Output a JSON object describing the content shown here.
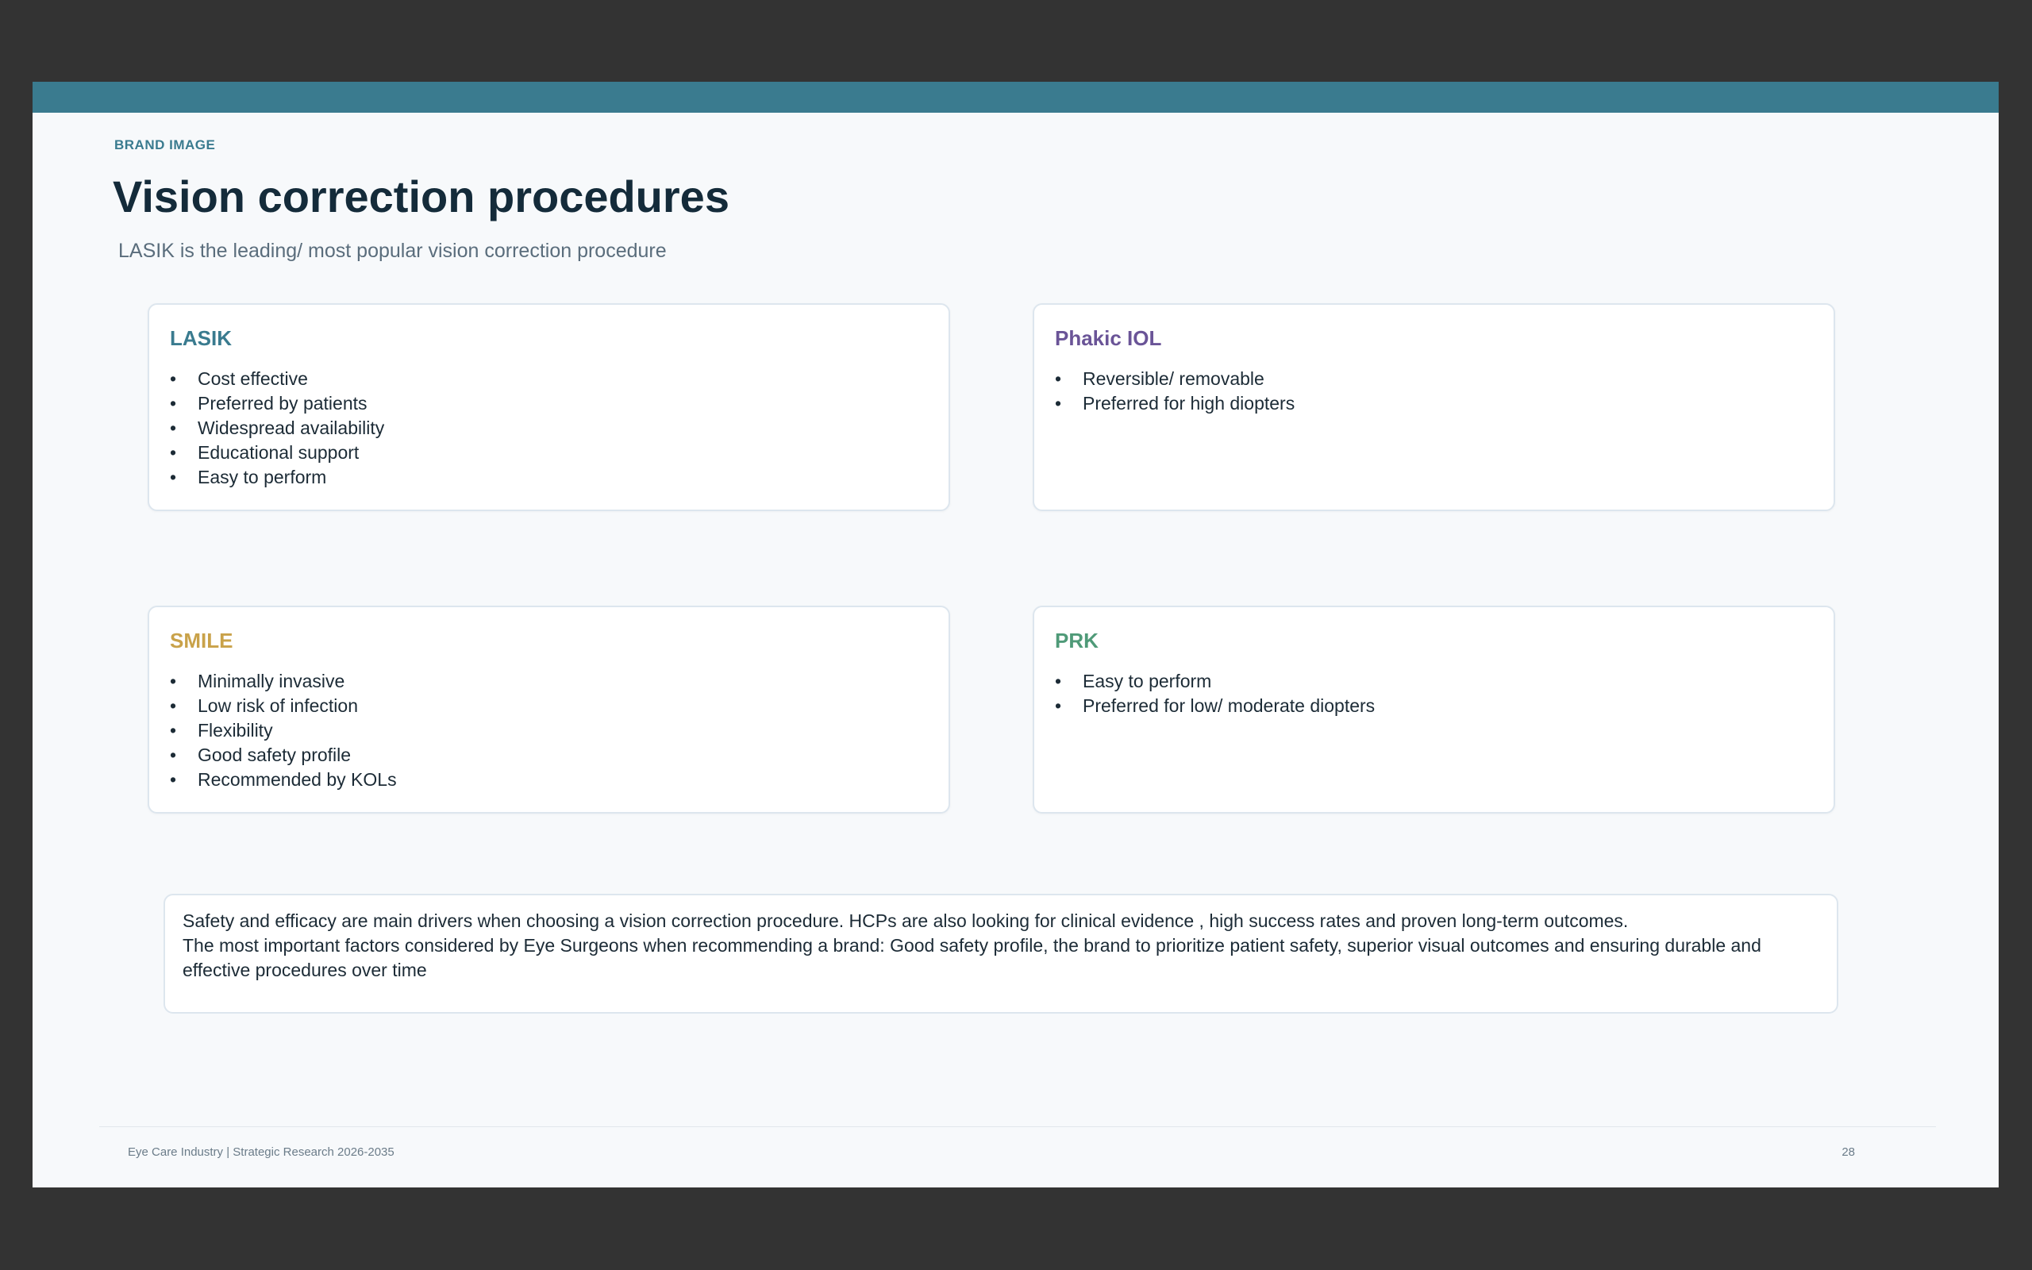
{
  "slide": {
    "section_label": "BRAND IMAGE",
    "title": "Vision correction procedures",
    "subtitle": "LASIK is the leading/ most popular vision correction procedure",
    "accent_color": "#3a7b8f"
  },
  "cards": {
    "lasik": {
      "title": "LASIK",
      "color": "#3a7b8f",
      "items": [
        "Cost effective",
        "Preferred by patients",
        "Widespread availability",
        "Educational support",
        "Easy to perform"
      ]
    },
    "phakic": {
      "title": "Phakic IOL",
      "color": "#6a5497",
      "items": [
        "Reversible/ removable",
        "Preferred for high diopters"
      ]
    },
    "smile": {
      "title": "SMILE",
      "color": "#c9a24a",
      "items": [
        "Minimally invasive",
        "Low risk of infection",
        "Flexibility",
        "Good safety profile",
        "Recommended by KOLs"
      ]
    },
    "prk": {
      "title": "PRK",
      "color": "#4f9a78",
      "items": [
        "Easy to perform",
        "Preferred for low/ moderate diopters"
      ]
    }
  },
  "summary": {
    "line1": "Safety and efficacy are main drivers when choosing a vision correction procedure. HCPs are also looking for clinical evidence , high success rates and proven long-term outcomes.",
    "line2": "The most important factors considered by Eye Surgeons when recommending a brand: Good safety profile, the brand to prioritize  patient safety, superior visual outcomes and ensuring durable and effective procedures over time"
  },
  "footer": {
    "text": "Eye Care Industry | Strategic Research 2026-2035",
    "page_number": "28"
  }
}
